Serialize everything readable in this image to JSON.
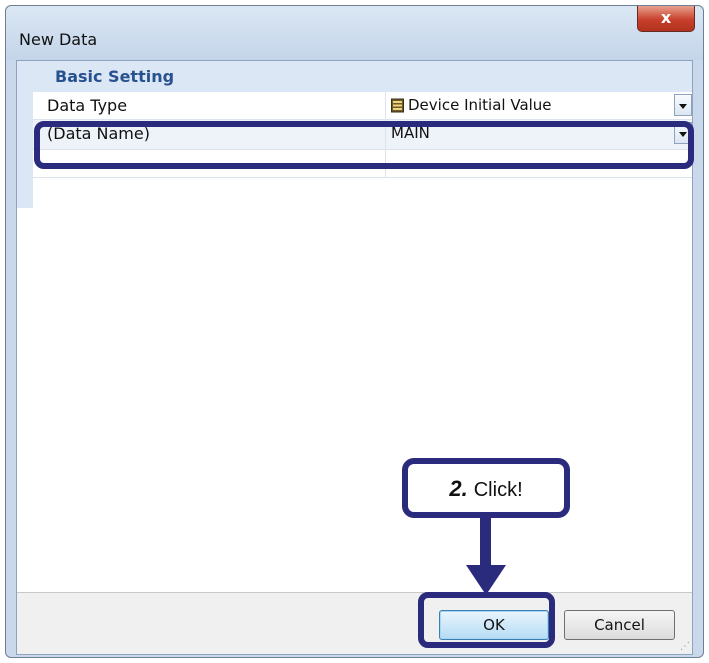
{
  "window": {
    "title": "New Data",
    "close_label": "x"
  },
  "property_grid": {
    "category": "Basic Setting",
    "rows": [
      {
        "name": "Data Type",
        "value": "Device Initial Value",
        "icon": "database-icon"
      },
      {
        "name": "(Data Name)",
        "value": "MAIN"
      },
      {
        "name": "",
        "value": ""
      }
    ]
  },
  "buttons": {
    "ok_label": "OK",
    "cancel_label": "Cancel"
  },
  "annotation": {
    "step_number": "2.",
    "step_text": "Click!"
  },
  "colors": {
    "annotation": "#2b2b7e",
    "category_text": "#27528f",
    "close_button": "#c7402b"
  }
}
